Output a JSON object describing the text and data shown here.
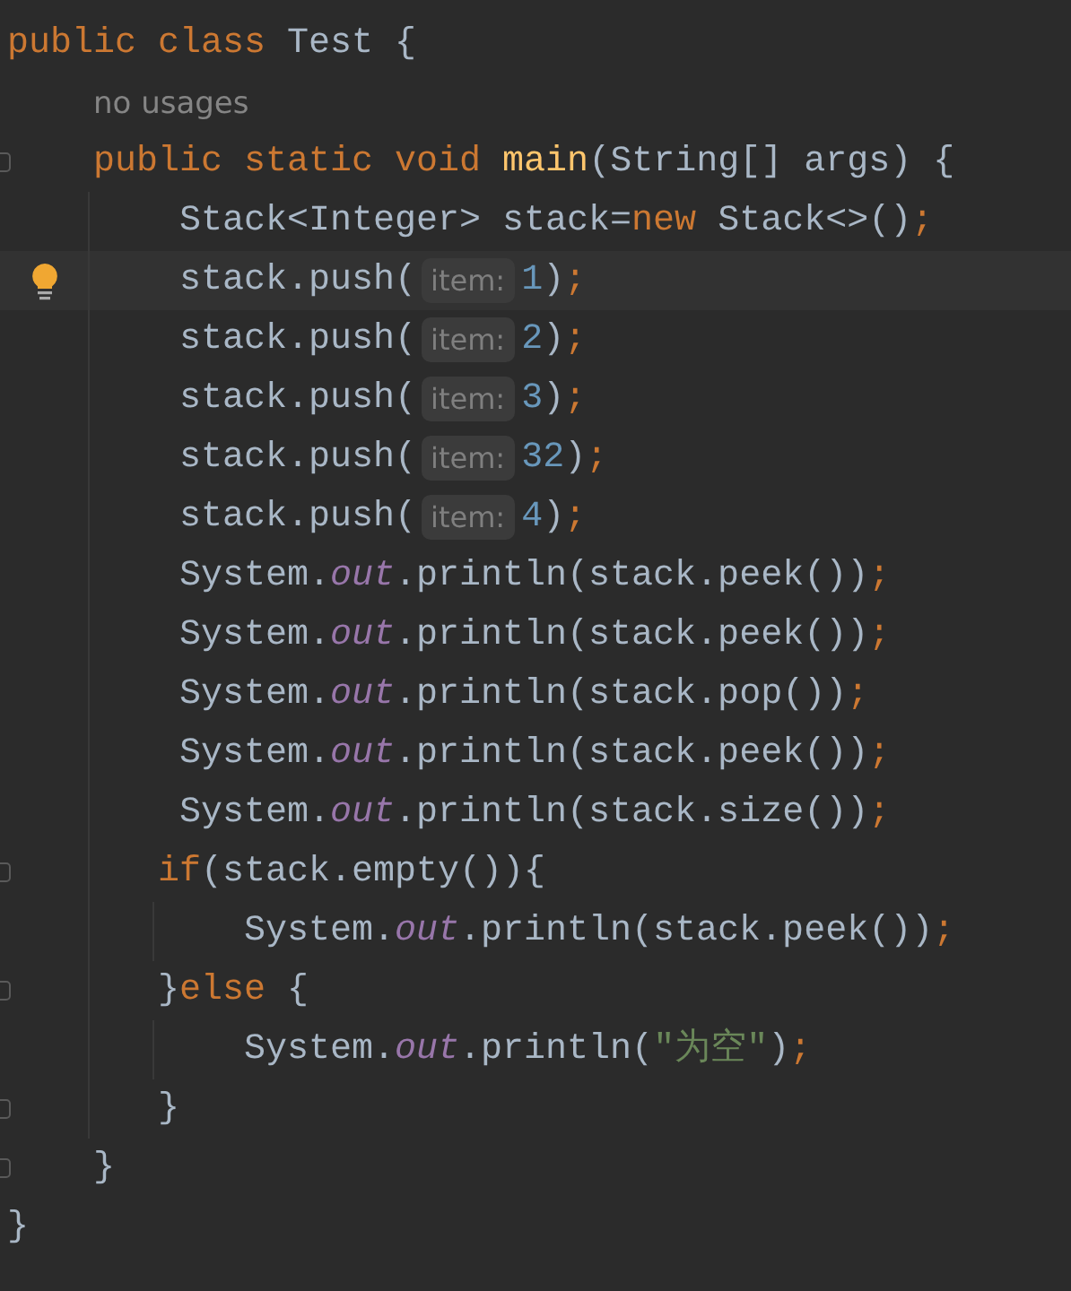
{
  "editor": {
    "lines": [
      {
        "kind": "code",
        "highlighted": false,
        "foldable": false,
        "tokens": [
          {
            "text": "public class ",
            "kind": "keyword"
          },
          {
            "text": "Test {",
            "kind": "plain"
          }
        ]
      },
      {
        "kind": "usage",
        "highlighted": false,
        "foldable": false,
        "tokens": [
          {
            "text": "    no usages",
            "kind": "usage"
          }
        ]
      },
      {
        "kind": "code",
        "highlighted": false,
        "foldable": true,
        "tokens": [
          {
            "text": "    public static void ",
            "kind": "keyword"
          },
          {
            "text": "main",
            "kind": "declaration"
          },
          {
            "text": "(String[] args) {",
            "kind": "plain"
          }
        ]
      },
      {
        "kind": "code",
        "highlighted": false,
        "foldable": false,
        "tokens": [
          {
            "text": "        Stack<Integer> stack=",
            "kind": "plain"
          },
          {
            "text": "new",
            "kind": "keyword"
          },
          {
            "text": " Stack<>()",
            "kind": "plain"
          },
          {
            "text": ";",
            "kind": "semicolon"
          }
        ]
      },
      {
        "kind": "code",
        "highlighted": true,
        "foldable": false,
        "tokens": [
          {
            "text": "        stack.push(",
            "kind": "plain"
          },
          {
            "text": "item:",
            "kind": "hint"
          },
          {
            "text": "1",
            "kind": "number"
          },
          {
            "text": ")",
            "kind": "plain"
          },
          {
            "text": ";",
            "kind": "semicolon"
          }
        ]
      },
      {
        "kind": "code",
        "highlighted": false,
        "foldable": false,
        "tokens": [
          {
            "text": "        stack.push(",
            "kind": "plain"
          },
          {
            "text": "item:",
            "kind": "hint"
          },
          {
            "text": "2",
            "kind": "number"
          },
          {
            "text": ")",
            "kind": "plain"
          },
          {
            "text": ";",
            "kind": "semicolon"
          }
        ]
      },
      {
        "kind": "code",
        "highlighted": false,
        "foldable": false,
        "tokens": [
          {
            "text": "        stack.push(",
            "kind": "plain"
          },
          {
            "text": "item:",
            "kind": "hint"
          },
          {
            "text": "3",
            "kind": "number"
          },
          {
            "text": ")",
            "kind": "plain"
          },
          {
            "text": ";",
            "kind": "semicolon"
          }
        ]
      },
      {
        "kind": "code",
        "highlighted": false,
        "foldable": false,
        "tokens": [
          {
            "text": "        stack.push(",
            "kind": "plain"
          },
          {
            "text": "item:",
            "kind": "hint"
          },
          {
            "text": "32",
            "kind": "number"
          },
          {
            "text": ")",
            "kind": "plain"
          },
          {
            "text": ";",
            "kind": "semicolon"
          }
        ]
      },
      {
        "kind": "code",
        "highlighted": false,
        "foldable": false,
        "tokens": [
          {
            "text": "        stack.push(",
            "kind": "plain"
          },
          {
            "text": "item:",
            "kind": "hint"
          },
          {
            "text": "4",
            "kind": "number"
          },
          {
            "text": ")",
            "kind": "plain"
          },
          {
            "text": ";",
            "kind": "semicolon"
          }
        ]
      },
      {
        "kind": "code",
        "highlighted": false,
        "foldable": false,
        "tokens": [
          {
            "text": "        System.",
            "kind": "plain"
          },
          {
            "text": "out",
            "kind": "field"
          },
          {
            "text": ".println(stack.peek())",
            "kind": "plain"
          },
          {
            "text": ";",
            "kind": "semicolon"
          }
        ]
      },
      {
        "kind": "code",
        "highlighted": false,
        "foldable": false,
        "tokens": [
          {
            "text": "        System.",
            "kind": "plain"
          },
          {
            "text": "out",
            "kind": "field"
          },
          {
            "text": ".println(stack.peek())",
            "kind": "plain"
          },
          {
            "text": ";",
            "kind": "semicolon"
          }
        ]
      },
      {
        "kind": "code",
        "highlighted": false,
        "foldable": false,
        "tokens": [
          {
            "text": "        System.",
            "kind": "plain"
          },
          {
            "text": "out",
            "kind": "field"
          },
          {
            "text": ".println(stack.pop())",
            "kind": "plain"
          },
          {
            "text": ";",
            "kind": "semicolon"
          }
        ]
      },
      {
        "kind": "code",
        "highlighted": false,
        "foldable": false,
        "tokens": [
          {
            "text": "        System.",
            "kind": "plain"
          },
          {
            "text": "out",
            "kind": "field"
          },
          {
            "text": ".println(stack.peek())",
            "kind": "plain"
          },
          {
            "text": ";",
            "kind": "semicolon"
          }
        ]
      },
      {
        "kind": "code",
        "highlighted": false,
        "foldable": false,
        "tokens": [
          {
            "text": "        System.",
            "kind": "plain"
          },
          {
            "text": "out",
            "kind": "field"
          },
          {
            "text": ".println(stack.size())",
            "kind": "plain"
          },
          {
            "text": ";",
            "kind": "semicolon"
          }
        ]
      },
      {
        "kind": "code",
        "highlighted": false,
        "foldable": true,
        "tokens": [
          {
            "text": "       if",
            "kind": "keyword"
          },
          {
            "text": "(stack.empty()){",
            "kind": "plain"
          }
        ]
      },
      {
        "kind": "code",
        "highlighted": false,
        "foldable": false,
        "tokens": [
          {
            "text": "           System.",
            "kind": "plain"
          },
          {
            "text": "out",
            "kind": "field"
          },
          {
            "text": ".println(stack.peek())",
            "kind": "plain"
          },
          {
            "text": ";",
            "kind": "semicolon"
          }
        ]
      },
      {
        "kind": "code",
        "highlighted": false,
        "foldable": true,
        "tokens": [
          {
            "text": "       }",
            "kind": "plain"
          },
          {
            "text": "else ",
            "kind": "keyword"
          },
          {
            "text": "{",
            "kind": "plain"
          }
        ]
      },
      {
        "kind": "code",
        "highlighted": false,
        "foldable": false,
        "tokens": [
          {
            "text": "           System.",
            "kind": "plain"
          },
          {
            "text": "out",
            "kind": "field"
          },
          {
            "text": ".println(",
            "kind": "plain"
          },
          {
            "text": "\"为空\"",
            "kind": "string"
          },
          {
            "text": ")",
            "kind": "plain"
          },
          {
            "text": ";",
            "kind": "semicolon"
          }
        ]
      },
      {
        "kind": "code",
        "highlighted": false,
        "foldable": true,
        "tokens": [
          {
            "text": "       }",
            "kind": "plain"
          }
        ]
      },
      {
        "kind": "code",
        "highlighted": false,
        "foldable": true,
        "tokens": [
          {
            "text": "    }",
            "kind": "plain"
          }
        ]
      },
      {
        "kind": "code",
        "highlighted": false,
        "foldable": false,
        "tokens": [
          {
            "text": "}",
            "kind": "plain"
          }
        ]
      }
    ]
  }
}
